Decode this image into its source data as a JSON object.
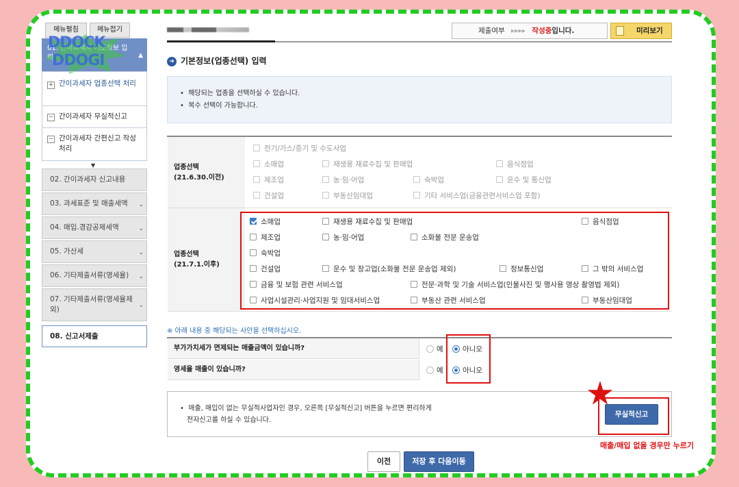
{
  "topbar": {
    "menu_expand": "메뉴펼침",
    "menu_collapse": "메뉴접기",
    "status_label": "제출여부",
    "status_arrows": "▸▸▸▸",
    "status_value": "작성중",
    "status_suffix": "입니다.",
    "preview_label": "미리보기"
  },
  "watermark": {
    "line1": "DDOCK",
    "line2": "DDOGI"
  },
  "sidebar": {
    "active_section": "01. 간이과세자 기초정보 입력",
    "sub_items": [
      {
        "label": "간이과세자 업종선택 처리",
        "icon": "plus-icon"
      },
      {
        "label": "간이과세자 무실적신고",
        "icon": "minus-icon"
      },
      {
        "label": "간이과세자 간편신고 작성 처리",
        "icon": "minus-icon"
      }
    ],
    "items": [
      {
        "label": "02. 간이과세자 신고내용"
      },
      {
        "label": "03. 과세표준 및 매출세액"
      },
      {
        "label": "04. 매입.경감공제세액"
      },
      {
        "label": "05. 가산세"
      },
      {
        "label": "06. 기타제출서류(영세율)"
      },
      {
        "label": "07. 기타제출서류(영세율제외)"
      },
      {
        "label": "08. 신고서제출"
      }
    ]
  },
  "main": {
    "section_title": "기본정보(업종선택) 입력",
    "notices": [
      "해당되는 업종을 선택하실 수 있습니다.",
      "복수 선택이 가능합니다."
    ],
    "old_label_1": "업종선택",
    "old_label_2": "(21.6.30.이전)",
    "old_items": [
      "전기/가스/증기 및 수도사업",
      "소매업",
      "재생용 재료수집 및 판매업",
      "음식점업",
      "제조업",
      "농·임·어업",
      "숙박업",
      "운수 및 통신업",
      "건설업",
      "부동산임대업",
      "기타 서비스업(금융관련서비스업 포함)"
    ],
    "new_label_1": "업종선택",
    "new_label_2": "(21.7.1.이후)",
    "new_items": [
      "소매업",
      "재생용 재료수집 및 판매업",
      "음식점업",
      "제조업",
      "농·임·어업",
      "소화물 전문 운송업",
      "숙박업",
      "건설업",
      "운수 및 창고업(소화물 전문 운송업 제외)",
      "정보통신업",
      "그 밖의 서비스업",
      "금융 및 보험 관련 서비스업",
      "전문·과학 및 기술 서비스업(인물사진 및 행사용 영상 촬영법 제외)",
      "사업시설관리·사업지원 및 임대서비스업",
      "부동산 관련 서비스업",
      "부동산임대업"
    ],
    "select_guide": "※ 아래 내용 중 해당되는 사안을 선택하십시오.",
    "questions": [
      {
        "text": "부가가치세가 면제되는 매출금액이 있습니까?",
        "yes": "예",
        "no": "아니오",
        "selected": "no"
      },
      {
        "text": "영세율 매출이 있습니까?",
        "yes": "예",
        "no": "아니오",
        "selected": "no"
      }
    ],
    "bottom_notice_1": "매출, 매입이 없는 무실적사업자인 경우, 오른쪽 [무실적신고] 버튼을 누르면 편리하게",
    "bottom_notice_2": "전자신고를 하실 수 있습니다.",
    "no_record_button": "무실적신고",
    "annotation": "매출/매입 없을 경우만 누르기",
    "prev_button": "이전",
    "next_button": "저장 후 다음이동"
  },
  "colors": {
    "accent": "#3b79c8",
    "annotation_red": "#e01010",
    "frame_green": "#22cc22",
    "background_pink": "#f8b9b9"
  }
}
